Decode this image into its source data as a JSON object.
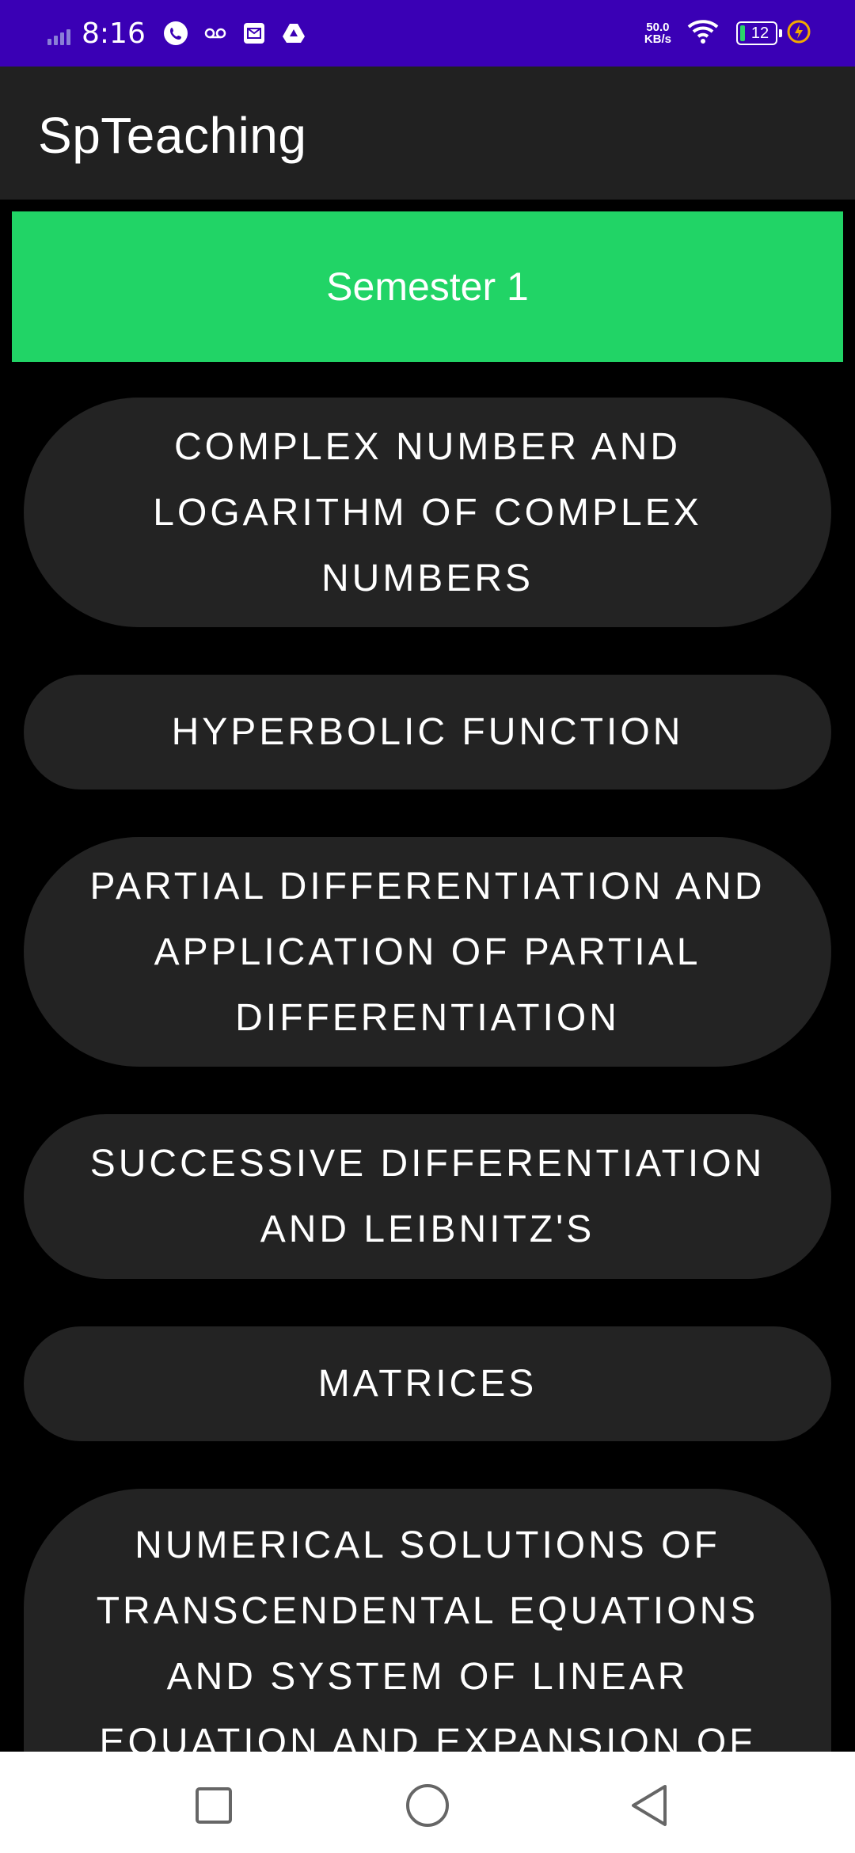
{
  "status_bar": {
    "time": "8:16",
    "net_speed_value": "50.0",
    "net_speed_unit": "KB/s",
    "battery_level": "12",
    "icons": [
      "signal-icon",
      "call-icon",
      "voicemail-icon",
      "mail-icon",
      "drive-icon",
      "wifi-icon",
      "battery-icon",
      "charging-icon"
    ]
  },
  "app": {
    "title": "SpTeaching"
  },
  "semester": {
    "label": "Semester 1"
  },
  "topics": [
    "COMPLEX NUMBER AND LOGARITHM OF COMPLEX NUMBERS",
    "HYPERBOLIC FUNCTION",
    "PARTIAL DIFFERENTIATION AND APPLICATION OF PARTIAL DIFFERENTIATION",
    "SUCCESSIVE DIFFERENTIATION AND LEIBNITZ'S",
    "MATRICES",
    "NUMERICAL SOLUTIONS OF TRANSCENDENTAL EQUATIONS AND SYSTEM OF LINEAR EQUATION AND EXPANSION OF"
  ],
  "nav": {
    "buttons": [
      "recent-apps-button",
      "home-button",
      "back-button"
    ]
  },
  "colors": {
    "status_bar": "#3a00b5",
    "app_bar": "#212121",
    "banner": "#21d466",
    "topic_bg": "#232323",
    "background": "#000000"
  }
}
